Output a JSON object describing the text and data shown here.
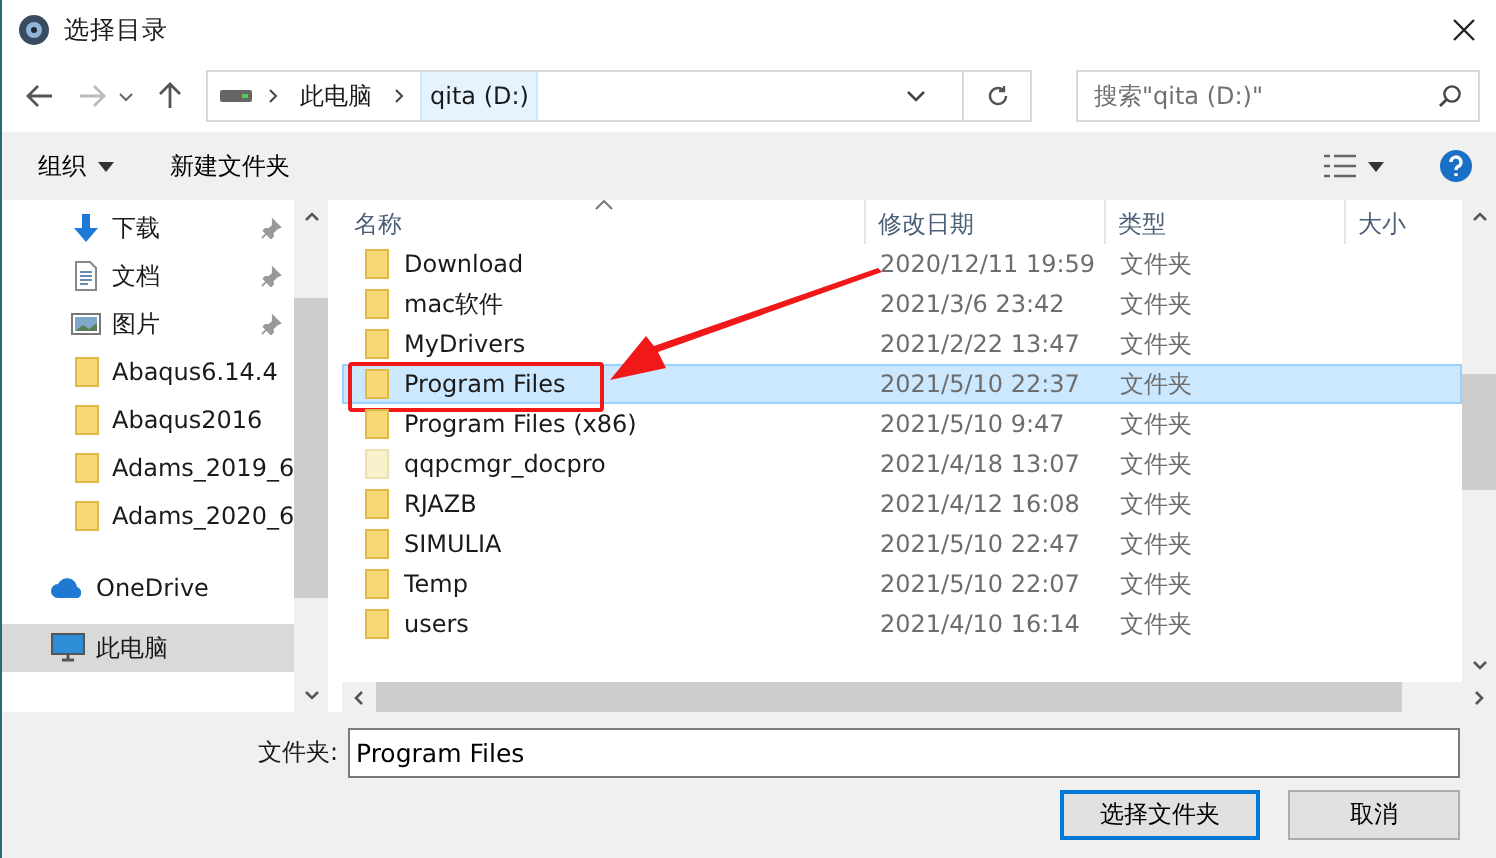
{
  "window": {
    "title": "选择目录"
  },
  "address": {
    "crumbs": [
      "此电脑",
      "qita (D:)"
    ],
    "search_placeholder": "搜索\"qita (D:)\""
  },
  "toolbar": {
    "organize": "组织",
    "new_folder": "新建文件夹"
  },
  "sidebar": {
    "items": [
      {
        "label": "下载",
        "kind": "download",
        "pinned": true,
        "selected": false
      },
      {
        "label": "文档",
        "kind": "document",
        "pinned": true,
        "selected": false
      },
      {
        "label": "图片",
        "kind": "picture",
        "pinned": true,
        "selected": false
      },
      {
        "label": "Abaqus6.14.4",
        "kind": "folder",
        "pinned": false,
        "selected": false
      },
      {
        "label": "Abaqus2016",
        "kind": "folder",
        "pinned": false,
        "selected": false
      },
      {
        "label": "Adams_2019_6",
        "kind": "folder",
        "pinned": false,
        "selected": false
      },
      {
        "label": "Adams_2020_6",
        "kind": "folder",
        "pinned": false,
        "selected": false
      },
      {
        "label": "OneDrive",
        "kind": "cloud",
        "pinned": false,
        "selected": false
      },
      {
        "label": "此电脑",
        "kind": "pc",
        "pinned": false,
        "selected": true
      }
    ]
  },
  "table": {
    "columns": [
      {
        "label": "名称",
        "sorted": true
      },
      {
        "label": "修改日期",
        "sorted": false
      },
      {
        "label": "类型",
        "sorted": false
      },
      {
        "label": "大小",
        "sorted": false
      }
    ],
    "rows": [
      {
        "name": "Download",
        "date": "2020/12/11 19:59",
        "type": "文件夹",
        "hidden": false,
        "selected": false,
        "highlighted": false
      },
      {
        "name": "mac软件",
        "date": "2021/3/6 23:42",
        "type": "文件夹",
        "hidden": false,
        "selected": false,
        "highlighted": false
      },
      {
        "name": "MyDrivers",
        "date": "2021/2/22 13:47",
        "type": "文件夹",
        "hidden": false,
        "selected": false,
        "highlighted": false
      },
      {
        "name": "Program Files",
        "date": "2021/5/10 22:37",
        "type": "文件夹",
        "hidden": false,
        "selected": true,
        "highlighted": true
      },
      {
        "name": "Program Files (x86)",
        "date": "2021/5/10 9:47",
        "type": "文件夹",
        "hidden": false,
        "selected": false,
        "highlighted": false
      },
      {
        "name": "qqpcmgr_docpro",
        "date": "2021/4/18 13:07",
        "type": "文件夹",
        "hidden": true,
        "selected": false,
        "highlighted": false
      },
      {
        "name": "RJAZB",
        "date": "2021/4/12 16:08",
        "type": "文件夹",
        "hidden": false,
        "selected": false,
        "highlighted": false
      },
      {
        "name": "SIMULIA",
        "date": "2021/5/10 22:47",
        "type": "文件夹",
        "hidden": false,
        "selected": false,
        "highlighted": false
      },
      {
        "name": "Temp",
        "date": "2021/5/10 22:07",
        "type": "文件夹",
        "hidden": false,
        "selected": false,
        "highlighted": false
      },
      {
        "name": "users",
        "date": "2021/4/10 16:14",
        "type": "文件夹",
        "hidden": false,
        "selected": false,
        "highlighted": false
      }
    ]
  },
  "folder_field": {
    "label": "文件夹:",
    "value": "Program Files"
  },
  "buttons": [
    {
      "label": "选择文件夹",
      "kind": "primary"
    },
    {
      "label": "取消",
      "kind": "normal"
    }
  ]
}
